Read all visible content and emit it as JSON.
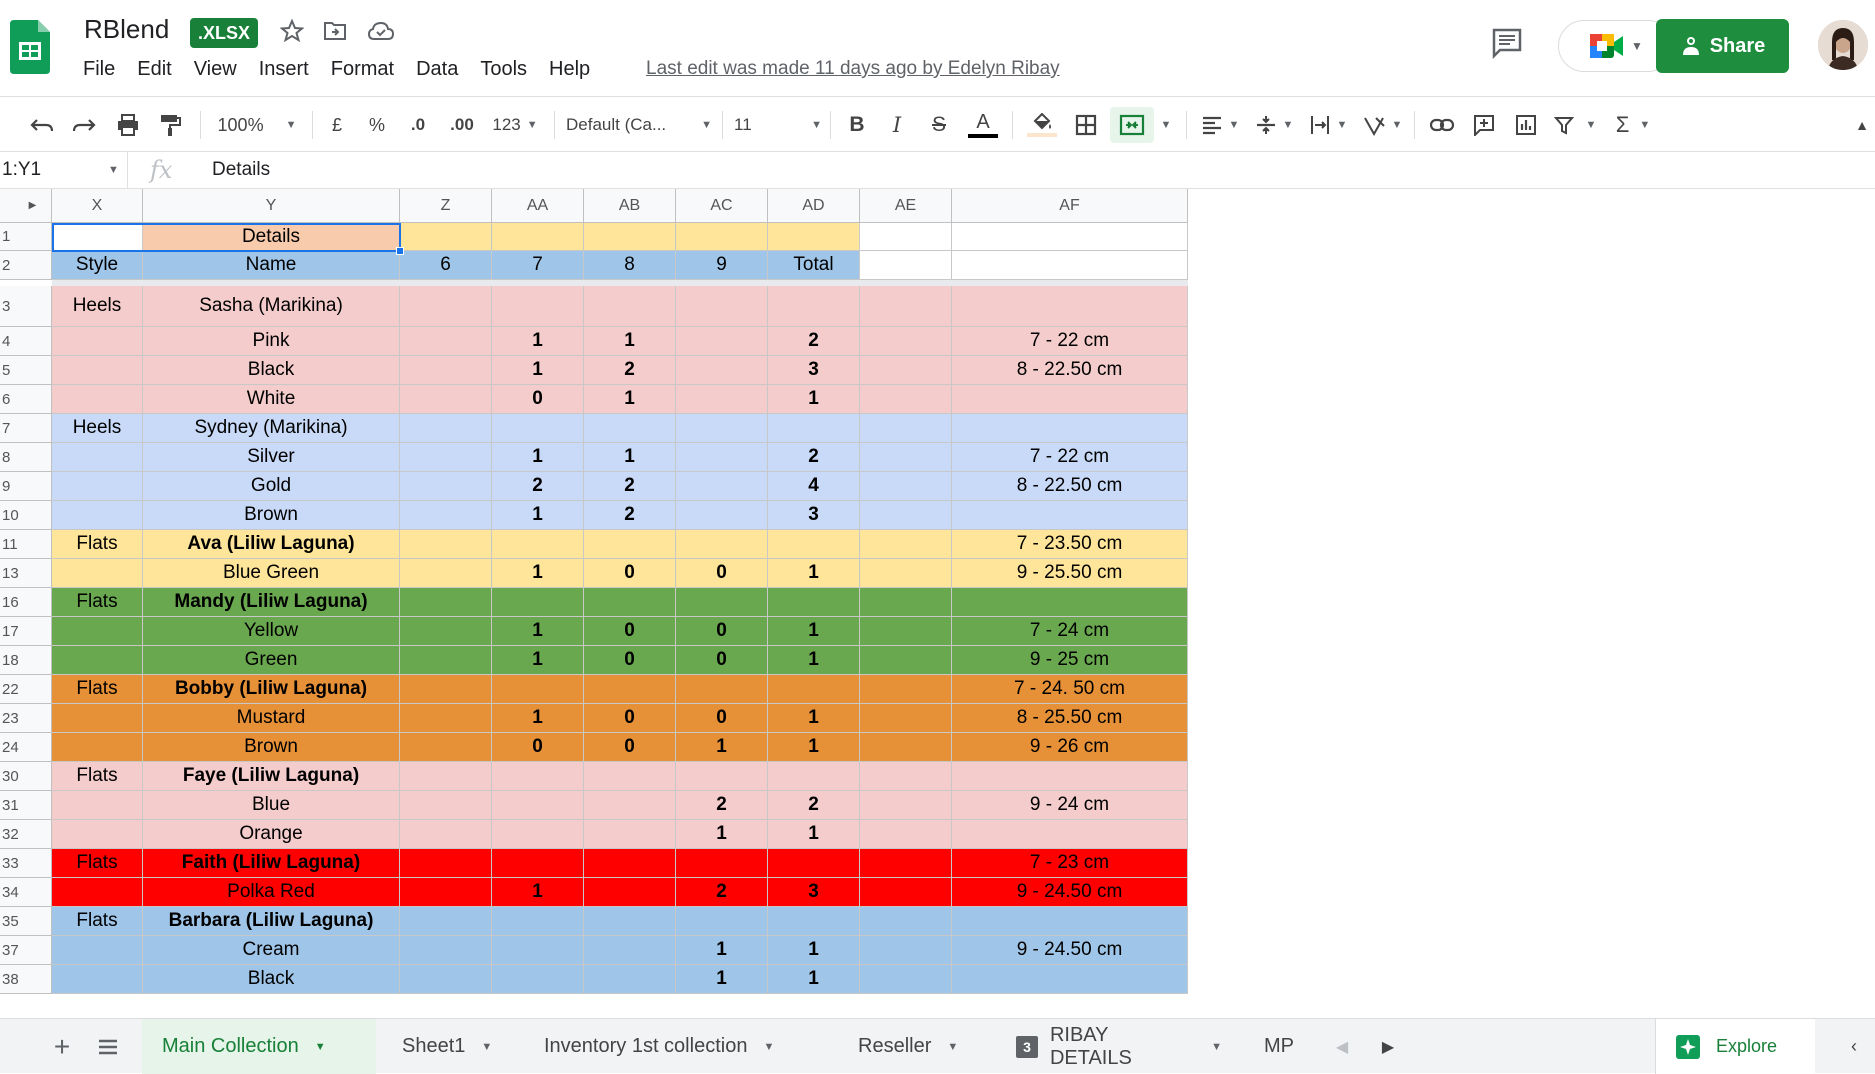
{
  "app": {
    "title": "RBlend",
    "badge": ".XLSX",
    "last_edit": "Last edit was made 11 days ago by Edelyn Ribay",
    "share_label": "Share",
    "menu": [
      "File",
      "Edit",
      "View",
      "Insert",
      "Format",
      "Data",
      "Tools",
      "Help"
    ]
  },
  "toolbar": {
    "zoom": "100%",
    "currency": "£",
    "percent": "%",
    "dec_decrease": ".0",
    "dec_increase": ".00",
    "more_formats": "123",
    "font": "Default (Ca...",
    "font_size": "11",
    "bold": "B",
    "italic": "I",
    "strike": "S",
    "text_color": "A",
    "sum": "Σ"
  },
  "formula_bar": {
    "name_box": "1:Y1",
    "fx": "fx",
    "content": "Details"
  },
  "columns": [
    "X",
    "Y",
    "Z",
    "AA",
    "AB",
    "AC",
    "AD",
    "AE",
    "AF"
  ],
  "rows": [
    {
      "num": "1",
      "cells": [
        "",
        "Details",
        "",
        "",
        "",
        "",
        "",
        "",
        ""
      ]
    },
    {
      "num": "2",
      "cells": [
        "Style",
        "Name",
        "6",
        "7",
        "8",
        "9",
        "Total",
        "",
        ""
      ]
    },
    {
      "num": "3",
      "cells": [
        "Heels",
        "Sasha (Marikina)",
        "",
        "",
        "",
        "",
        "",
        "",
        ""
      ]
    },
    {
      "num": "4",
      "cells": [
        "",
        "Pink",
        "",
        "1",
        "1",
        "",
        "2",
        "",
        "7 - 22 cm"
      ]
    },
    {
      "num": "5",
      "cells": [
        "",
        "Black",
        "",
        "1",
        "2",
        "",
        "3",
        "",
        "8 - 22.50 cm"
      ]
    },
    {
      "num": "6",
      "cells": [
        "",
        "White",
        "",
        "0",
        "1",
        "",
        "1",
        "",
        ""
      ]
    },
    {
      "num": "7",
      "cells": [
        "Heels",
        "Sydney (Marikina)",
        "",
        "",
        "",
        "",
        "",
        "",
        ""
      ]
    },
    {
      "num": "8",
      "cells": [
        "",
        "Silver",
        "",
        "1",
        "1",
        "",
        "2",
        "",
        "7 - 22 cm"
      ]
    },
    {
      "num": "9",
      "cells": [
        "",
        "Gold",
        "",
        "2",
        "2",
        "",
        "4",
        "",
        "8 - 22.50 cm"
      ]
    },
    {
      "num": "10",
      "cells": [
        "",
        "Brown",
        "",
        "1",
        "2",
        "",
        "3",
        "",
        ""
      ]
    },
    {
      "num": "11",
      "cells": [
        "Flats",
        "Ava (Liliw Laguna)",
        "",
        "",
        "",
        "",
        "",
        "",
        "7 - 23.50 cm"
      ]
    },
    {
      "num": "13",
      "cells": [
        "",
        "Blue Green",
        "",
        "1",
        "0",
        "0",
        "1",
        "",
        "9 - 25.50 cm"
      ]
    },
    {
      "num": "16",
      "cells": [
        "Flats",
        "Mandy (Liliw Laguna)",
        "",
        "",
        "",
        "",
        "",
        "",
        ""
      ]
    },
    {
      "num": "17",
      "cells": [
        "",
        "Yellow",
        "",
        "1",
        "0",
        "0",
        "1",
        "",
        "7 - 24 cm"
      ]
    },
    {
      "num": "18",
      "cells": [
        "",
        "Green",
        "",
        "1",
        "0",
        "0",
        "1",
        "",
        "9 - 25 cm"
      ]
    },
    {
      "num": "22",
      "cells": [
        "Flats",
        "Bobby (Liliw Laguna)",
        "",
        "",
        "",
        "",
        "",
        "",
        "7 - 24. 50 cm"
      ]
    },
    {
      "num": "23",
      "cells": [
        "",
        "Mustard",
        "",
        "1",
        "0",
        "0",
        "1",
        "",
        "8 - 25.50 cm"
      ]
    },
    {
      "num": "24",
      "cells": [
        "",
        "Brown",
        "",
        "0",
        "0",
        "1",
        "1",
        "",
        "9 - 26 cm"
      ]
    },
    {
      "num": "30",
      "cells": [
        "Flats",
        "Faye (Liliw Laguna)",
        "",
        "",
        "",
        "",
        "",
        "",
        ""
      ]
    },
    {
      "num": "31",
      "cells": [
        "",
        "Blue",
        "",
        "",
        "",
        "2",
        "2",
        "",
        "9 - 24 cm"
      ]
    },
    {
      "num": "32",
      "cells": [
        "",
        "Orange",
        "",
        "",
        "",
        "1",
        "1",
        "",
        ""
      ]
    },
    {
      "num": "33",
      "cells": [
        "Flats",
        "Faith (Liliw Laguna)",
        "",
        "",
        "",
        "",
        "",
        "",
        "7 - 23 cm"
      ]
    },
    {
      "num": "34",
      "cells": [
        "",
        "Polka Red",
        "",
        "1",
        "",
        "2",
        "3",
        "",
        "9 - 24.50 cm"
      ]
    },
    {
      "num": "35",
      "cells": [
        "Flats",
        "Barbara (Liliw Laguna)",
        "",
        "",
        "",
        "",
        "",
        "",
        ""
      ]
    },
    {
      "num": "37",
      "cells": [
        "",
        "Cream",
        "",
        "",
        "",
        "1",
        "1",
        "",
        "9 - 24.50 cm"
      ]
    },
    {
      "num": "38",
      "cells": [
        "",
        "Black",
        "",
        "",
        "",
        "1",
        "1",
        "",
        ""
      ]
    }
  ],
  "row_colors": [
    "#f7cbac",
    "#9fc5e8",
    "#f4cccc",
    "#f4cccc",
    "#f4cccc",
    "#f4cccc",
    "#c9daf8",
    "#c9daf8",
    "#c9daf8",
    "#c9daf8",
    "#ffe599",
    "#ffe599",
    "#6aa84f",
    "#6aa84f",
    "#6aa84f",
    "#e69138",
    "#e69138",
    "#e69138",
    "#f4cccc",
    "#f4cccc",
    "#f4cccc",
    "#ff0000",
    "#ff0000",
    "#9fc5e8",
    "#9fc5e8",
    "#9fc5e8"
  ],
  "sheet_tabs": [
    {
      "label": "Main Collection",
      "active": true
    },
    {
      "label": "Sheet1",
      "active": false
    },
    {
      "label": "Inventory 1st collection",
      "active": false
    },
    {
      "label": "Reseller",
      "active": false
    },
    {
      "label": "RIBAY DETAILS",
      "active": false
    },
    {
      "label": "MP",
      "active": false
    }
  ],
  "explore_label": "Explore",
  "colors": {
    "brand_green": "#188038",
    "share_green": "#1e8e3e",
    "selection_blue": "#1a73e8"
  }
}
